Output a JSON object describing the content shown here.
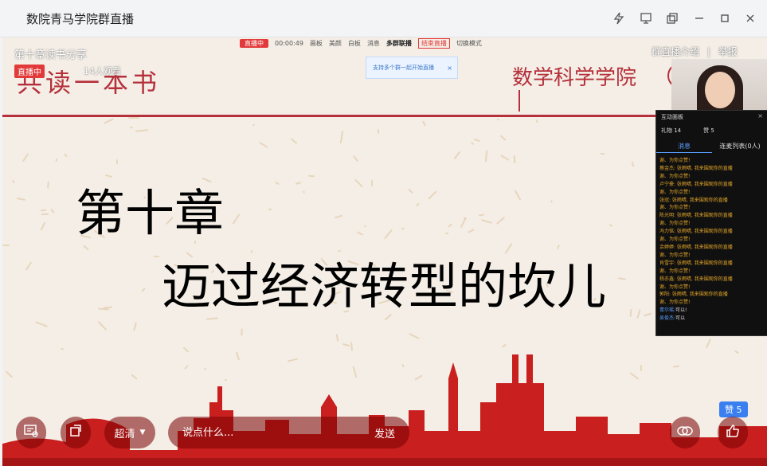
{
  "window": {
    "title": "数院青马学院群直播"
  },
  "live": {
    "session_title": "第十章读书分享",
    "status_badge": "直播中",
    "viewers": "14人观看",
    "intro_link": "群直播介绍",
    "separator": "|",
    "report_link": "举报"
  },
  "toolstrip": {
    "recording": "直播中",
    "timer": "00:00:49",
    "items": [
      "画板",
      "美颜",
      "白板",
      "消息",
      "多群联播"
    ],
    "end_button": "结束直播",
    "mode_button": "切换模式"
  },
  "hint": {
    "text": "支持多个群一起开始直播",
    "close": "×"
  },
  "slide": {
    "header_left": "共读一本书",
    "header_right": "数学科学学院",
    "chapter": "第十章",
    "subtitle": "迈过经济转型的坎儿"
  },
  "panel": {
    "title": "互动面板",
    "close": "×",
    "gifts": "礼物 14",
    "likes": "赞 5",
    "tab_messages": "消息",
    "tab_queue": "连麦列表(0人)",
    "messages": [
      {
        "kind": "sys",
        "text": "谢、为你点赞!"
      },
      {
        "kind": "sys",
        "text": "蔡金杰: 张雨晴, 我来围观你的直播"
      },
      {
        "kind": "sys",
        "text": "谢、为你点赞!"
      },
      {
        "kind": "sys",
        "text": "卢宁豪: 张雨晴, 我来围观你的直播"
      },
      {
        "kind": "sys",
        "text": "谢、为你点赞!"
      },
      {
        "kind": "sys",
        "text": "张冠: 张雨晴, 我来围观你的直播"
      },
      {
        "kind": "sys",
        "text": "谢、为你点赞!"
      },
      {
        "kind": "sys",
        "text": "陈光明: 张雨晴, 我来围观你的直播"
      },
      {
        "kind": "sys",
        "text": "谢、为你点赞!"
      },
      {
        "kind": "sys",
        "text": "冯力铭: 张雨晴, 我来围观你的直播"
      },
      {
        "kind": "sys",
        "text": "谢、为你点赞!"
      },
      {
        "kind": "sys",
        "text": "余婷婷: 张雨晴, 我来围观你的直播"
      },
      {
        "kind": "sys",
        "text": "谢、为你点赞!"
      },
      {
        "kind": "sys",
        "text": "肖雪宇: 张雨晴, 我来围观你的直播"
      },
      {
        "kind": "sys",
        "text": "谢、为你点赞!"
      },
      {
        "kind": "sys",
        "text": "杨亦鑫: 张雨晴, 我来围观你的直播"
      },
      {
        "kind": "sys",
        "text": "谢、为你点赞!"
      },
      {
        "kind": "sys",
        "text": "郭阳: 张雨晴, 我来围观你的直播"
      },
      {
        "kind": "sys",
        "text": "谢、为你点赞!"
      },
      {
        "kind": "chat",
        "name": "青尔瑶:",
        "text": "可以!"
      },
      {
        "kind": "chat",
        "name": "吴俊杰:",
        "text": "可以"
      }
    ]
  },
  "controls": {
    "quality": "超清",
    "comment_placeholder": "说点什么...",
    "send": "发送",
    "like_count": "赞 5"
  },
  "colors": {
    "accent_red": "#b5303b",
    "live_red": "#e23a3a",
    "panel_bg": "#101010",
    "link_blue": "#5aa0ff",
    "system_msg": "#e3a72a"
  }
}
